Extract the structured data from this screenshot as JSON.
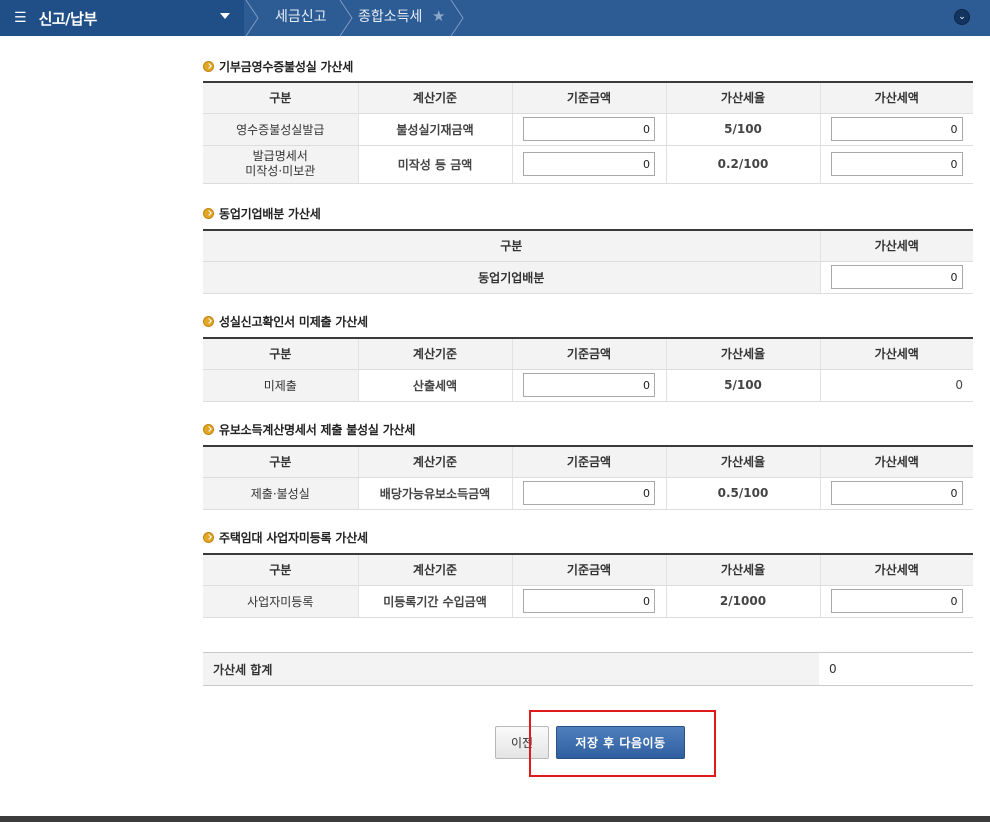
{
  "nav": {
    "menu_title": "신고/납부",
    "breadcrumb": [
      "세금신고",
      "종합소득세"
    ]
  },
  "sections": [
    {
      "title": "기부금영수증불성실 가산세",
      "headers": [
        "구분",
        "계산기준",
        "기준금액",
        "가산세율",
        "가산세액"
      ],
      "rows": [
        {
          "category": "영수증불성실발급",
          "basis": "불성실기재금액",
          "base_amount": "0",
          "rate": "5/100",
          "tax": "0"
        },
        {
          "category_line1": "발급명세서",
          "category_line2": "미작성·미보관",
          "basis": "미작성 등 금액",
          "base_amount": "0",
          "rate": "0.2/100",
          "tax": "0"
        }
      ]
    },
    {
      "title": "동업기업배분 가산세",
      "headers": [
        "구분",
        "가산세액"
      ],
      "rows": [
        {
          "category": "동업기업배분",
          "tax": "0"
        }
      ]
    },
    {
      "title": "성실신고확인서 미제출 가산세",
      "headers": [
        "구분",
        "계산기준",
        "기준금액",
        "가산세율",
        "가산세액"
      ],
      "rows": [
        {
          "category": "미제출",
          "basis": "산출세액",
          "base_amount": "0",
          "rate": "5/100",
          "tax": "0"
        }
      ]
    },
    {
      "title": "유보소득계산명세서 제출 불성실 가산세",
      "headers": [
        "구분",
        "계산기준",
        "기준금액",
        "가산세율",
        "가산세액"
      ],
      "rows": [
        {
          "category": "제출·불성실",
          "basis": "배당가능유보소득금액",
          "base_amount": "0",
          "rate": "0.5/100",
          "tax": "0"
        }
      ]
    },
    {
      "title": "주택임대 사업자미등록 가산세",
      "headers": [
        "구분",
        "계산기준",
        "기준금액",
        "가산세율",
        "가산세액"
      ],
      "rows": [
        {
          "category": "사업자미등록",
          "basis": "미등록기간 수입금액",
          "base_amount": "0",
          "rate": "2/1000",
          "tax": "0"
        }
      ]
    }
  ],
  "total": {
    "label": "가산세 합계",
    "value": "0"
  },
  "buttons": {
    "prev": "이전",
    "next": "저장 후 다음이동"
  },
  "colors": {
    "nav_bg": "#2d5b94",
    "menu_bg": "#1f4f86",
    "primary_button": "#3a6aab",
    "highlight": "#e01a1a",
    "bullet": "#e2a524"
  }
}
